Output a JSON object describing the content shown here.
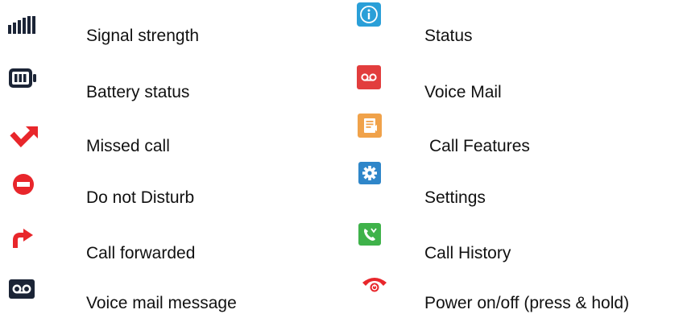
{
  "legend": {
    "left": [
      {
        "icon": "signal-strength-icon",
        "label": "Signal strength"
      },
      {
        "icon": "battery-icon",
        "label": "Battery status"
      },
      {
        "icon": "missed-call-icon",
        "label": "Missed call"
      },
      {
        "icon": "do-not-disturb-icon",
        "label": "Do not Disturb"
      },
      {
        "icon": "call-forwarded-icon",
        "label": "Call forwarded"
      },
      {
        "icon": "voicemail-message-icon",
        "label": "Voice mail message"
      }
    ],
    "right": [
      {
        "icon": "status-info-icon",
        "label": "Status"
      },
      {
        "icon": "voicemail-app-icon",
        "label": "Voice Mail"
      },
      {
        "icon": "call-features-icon",
        "label": "Call Features"
      },
      {
        "icon": "settings-gear-icon",
        "label": "Settings"
      },
      {
        "icon": "call-history-icon",
        "label": "Call History"
      },
      {
        "icon": "power-phone-icon",
        "label": "Power on/off (press & hold)"
      }
    ]
  },
  "colors": {
    "dark_navy": "#1b2436",
    "red": "#e8262b",
    "status_blue": "#2a9fd8",
    "voicemail_red": "#e23d3d",
    "features_orange": "#f0a24a",
    "settings_blue": "#2f86c9",
    "history_green": "#3fb24a"
  }
}
